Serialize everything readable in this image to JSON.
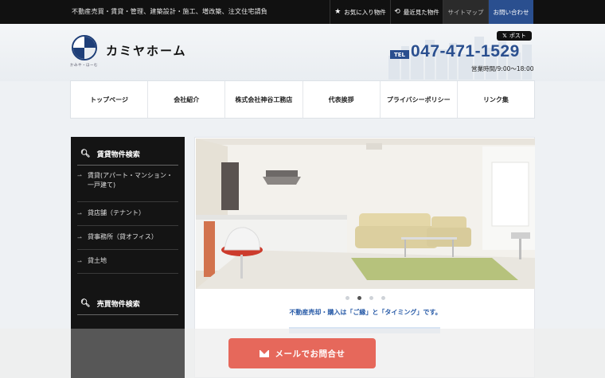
{
  "topbar": {
    "tagline": "不動産売買・賃貸・管理、建築設計・施工、増改築、注文住宅請負",
    "links": {
      "favorites": "お気に入り物件",
      "recent": "最近見た物件",
      "sitemap": "サイトマップ",
      "contact": "お問い合わせ"
    }
  },
  "header": {
    "logo_sub": "かみや・ほーむ",
    "brand": "カミヤホーム",
    "post_label": "ポスト",
    "tel_badge": "TEL",
    "tel_number": "047-471-1529",
    "hours": "営業時間/9:00〜18:00"
  },
  "nav": {
    "items": [
      "トップページ",
      "会社紹介",
      "株式会社神谷工務店",
      "代表挨拶",
      "プライバシーポリシー",
      "リンク集"
    ]
  },
  "sidebar": {
    "rental": {
      "title": "賃貸物件検索",
      "items": [
        "賃貸(アパート・マンション・一戸建て)",
        "貸店舗（テナント）",
        "貸事務所（貸オフィス）",
        "貸土地"
      ]
    },
    "sale": {
      "title": "売買物件検索"
    }
  },
  "slider": {
    "caption": "不動産売却・購入は「ご縁」と「タイミング」です。",
    "dot_count": 4,
    "active_dot": 1
  },
  "cta": {
    "mail_label": "メールでお問合せ"
  },
  "colors": {
    "brand_blue": "#2a4f8f",
    "cta_red": "#e6685b",
    "sidebar_bg": "#141414"
  }
}
